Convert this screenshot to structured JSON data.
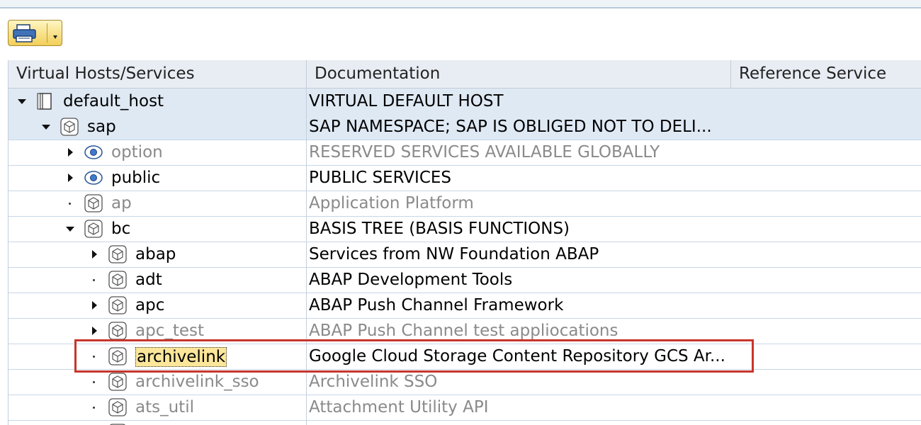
{
  "toolbar": {
    "print_icon": "printer-icon",
    "menu_icon": "dropdown-caret-icon"
  },
  "columns": {
    "services": "Virtual Hosts/Services",
    "documentation": "Documentation",
    "reference": "Reference Service"
  },
  "tree": [
    {
      "name": "default_host",
      "doc": "VIRTUAL DEFAULT HOST",
      "state": "expanded",
      "icon": "host-page-icon",
      "muted": false
    },
    {
      "name": "sap",
      "doc": "SAP NAMESPACE; SAP IS OBLIGED NOT TO DELI...",
      "state": "expanded",
      "icon": "service-cube-icon",
      "muted": false
    },
    {
      "name": "option",
      "doc": "RESERVED SERVICES AVAILABLE GLOBALLY",
      "state": "collapsed",
      "icon": "eye-icon",
      "muted": true
    },
    {
      "name": "public",
      "doc": "PUBLIC SERVICES",
      "state": "collapsed",
      "icon": "eye-icon",
      "muted": false
    },
    {
      "name": "ap",
      "doc": "Application Platform",
      "state": "leaf",
      "icon": "service-cube-icon",
      "muted": true
    },
    {
      "name": "bc",
      "doc": "BASIS TREE (BASIS FUNCTIONS)",
      "state": "expanded",
      "icon": "service-cube-icon",
      "muted": false
    },
    {
      "name": "abap",
      "doc": "Services from NW Foundation ABAP",
      "state": "collapsed",
      "icon": "service-cube-icon",
      "muted": false
    },
    {
      "name": "adt",
      "doc": "ABAP Development Tools",
      "state": "leaf",
      "icon": "service-cube-icon",
      "muted": false
    },
    {
      "name": "apc",
      "doc": "ABAP Push Channel Framework",
      "state": "collapsed",
      "icon": "service-cube-icon",
      "muted": false
    },
    {
      "name": "apc_test",
      "doc": "ABAP Push Channel test appliocations",
      "state": "collapsed",
      "icon": "service-cube-icon",
      "muted": true
    },
    {
      "name": "archivelink",
      "doc": "Google Cloud Storage Content Repository GCS Ar...",
      "state": "leaf",
      "icon": "service-cube-icon",
      "muted": false,
      "highlighted": true
    },
    {
      "name": "archivelink_sso",
      "doc": "Archivelink SSO",
      "state": "leaf",
      "icon": "service-cube-icon",
      "muted": true
    },
    {
      "name": "ats_util",
      "doc": "Attachment Utility API",
      "state": "leaf",
      "icon": "service-cube-icon",
      "muted": true
    },
    {
      "name": "",
      "doc": "",
      "state": "leaf",
      "icon": "service-cube-icon",
      "muted": true
    }
  ],
  "colors": {
    "selected_row": "#dfe9f4",
    "muted_text": "#8a8a8a",
    "highlight_box": "#c8352c"
  }
}
